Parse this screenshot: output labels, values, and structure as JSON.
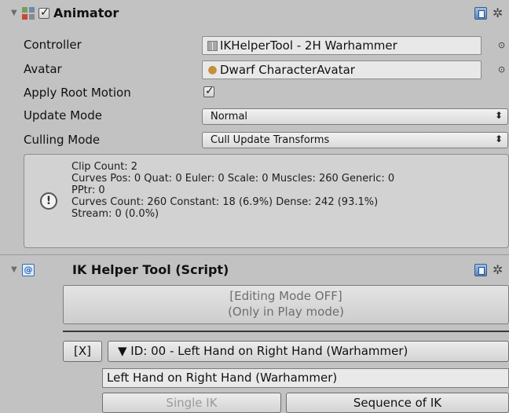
{
  "animator": {
    "title": "Animator",
    "enabled": true,
    "icon": "animator-icon",
    "properties": {
      "controller": {
        "label": "Controller",
        "value": "IKHelperTool - 2H Warhammer",
        "icon": "animator-controller-icon"
      },
      "avatar": {
        "label": "Avatar",
        "value": "Dwarf CharacterAvatar",
        "icon": "avatar-icon"
      },
      "apply_root_motion": {
        "label": "Apply Root Motion",
        "checked": true
      },
      "update_mode": {
        "label": "Update Mode",
        "value": "Normal"
      },
      "culling_mode": {
        "label": "Culling Mode",
        "value": "Cull Update Transforms"
      }
    },
    "info_lines": [
      "Clip Count: 2",
      "Curves Pos: 0 Quat: 0 Euler: 0 Scale: 0 Muscles: 260 Generic: 0",
      "PPtr: 0",
      "Curves Count: 260 Constant: 18 (6.9%) Dense: 242 (93.1%)",
      "Stream: 0 (0.0%)"
    ],
    "glyphs": {
      "foldout": "▼",
      "check": "✓",
      "gear": "✲",
      "picker": "⊙",
      "updown": "⬍",
      "info": "!"
    }
  },
  "script_component": {
    "title": "IK Helper Tool (Script)",
    "icon_glyph": "@",
    "editing_mode_line1": "[Editing Mode OFF]",
    "editing_mode_line2": "(Only in Play mode)",
    "remove_button": "[X]",
    "entry_foldout": "▼ ID: 00 - Left Hand on Right Hand (Warhammer)",
    "entry_name": "Left Hand on Right Hand (Warhammer)",
    "single_ik": "Single IK",
    "sequence_of_ik": "Sequence of IK"
  },
  "colors": {
    "background": "#c2c2c2",
    "info_box": "#d2d2d2",
    "field": "#e8e8e8",
    "disabled_text": "#9a9a9a"
  }
}
